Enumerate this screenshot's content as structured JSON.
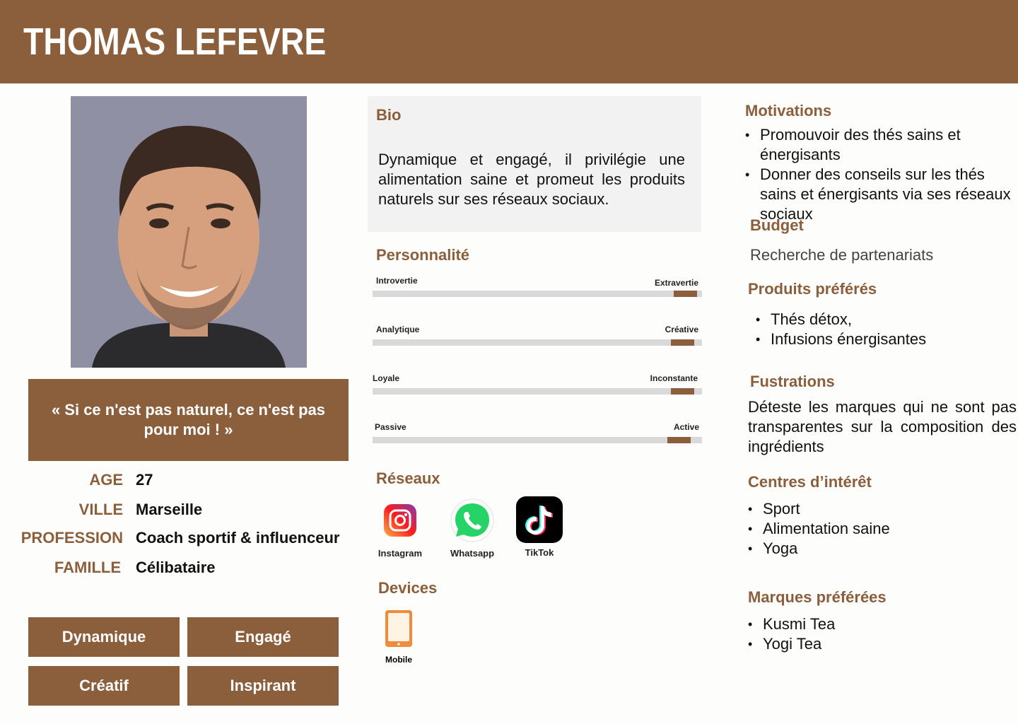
{
  "header": {
    "name": "THOMAS LEFEVRE"
  },
  "quote": "« Si ce n'est pas naturel, ce n'est pas pour moi ! »",
  "facts": [
    {
      "label": "AGE",
      "value": "27"
    },
    {
      "label": "VILLE",
      "value": "Marseille"
    },
    {
      "label": "PROFESSION",
      "value": "Coach sportif & influenceur"
    },
    {
      "label": "FAMILLE",
      "value": "Célibataire"
    }
  ],
  "tags": [
    "Dynamique",
    "Engagé",
    "Créatif",
    "Inspirant"
  ],
  "bio": {
    "title": "Bio",
    "text": "Dynamique et engagé, il privilégie une alimentation saine et promeut les produits naturels sur ses réseaux sociaux."
  },
  "personality": {
    "title": "Personnalité",
    "traits": [
      {
        "left": "Introvertie",
        "right": "Extravertie",
        "value": 0.95
      },
      {
        "left": "Analytique",
        "right": "Créative",
        "value": 0.94
      },
      {
        "left": "Loyale",
        "right": "Inconstante",
        "value": 0.94
      },
      {
        "left": "Passive",
        "right": "Active",
        "value": 0.93
      }
    ]
  },
  "networks": {
    "title": "Réseaux",
    "items": [
      {
        "label": "Instagram",
        "icon": "instagram-icon"
      },
      {
        "label": "Whatsapp",
        "icon": "whatsapp-icon"
      },
      {
        "label": "TikTok",
        "icon": "tiktok-icon"
      }
    ]
  },
  "devices": {
    "title": "Devices",
    "items": [
      {
        "label": "Mobile",
        "icon": "tablet-icon"
      }
    ]
  },
  "motivations": {
    "title": "Motivations",
    "items": [
      "Promouvoir des thés sains et énergisants",
      "Donner des conseils sur les thés sains et énergisants via ses réseaux sociaux"
    ]
  },
  "budget": {
    "title": "Budget",
    "text": "Recherche de partenariats"
  },
  "products": {
    "title": "Produits préférés",
    "items": [
      "Thés détox,",
      "Infusions énergisantes"
    ]
  },
  "frustrations": {
    "title": "Fustrations",
    "text": "Déteste les marques qui ne sont pas transparentes sur la composition des ingrédients"
  },
  "interests": {
    "title": "Centres d’intérêt",
    "items": [
      "Sport",
      "Alimentation saine",
      "Yoga"
    ]
  },
  "brands": {
    "title": "Marques préférées",
    "items": [
      "Kusmi Tea",
      "Yogi Tea"
    ]
  },
  "colors": {
    "accent": "#8b5e3c",
    "bio_bg": "#f2f2f2",
    "track": "#d9d9d9"
  }
}
